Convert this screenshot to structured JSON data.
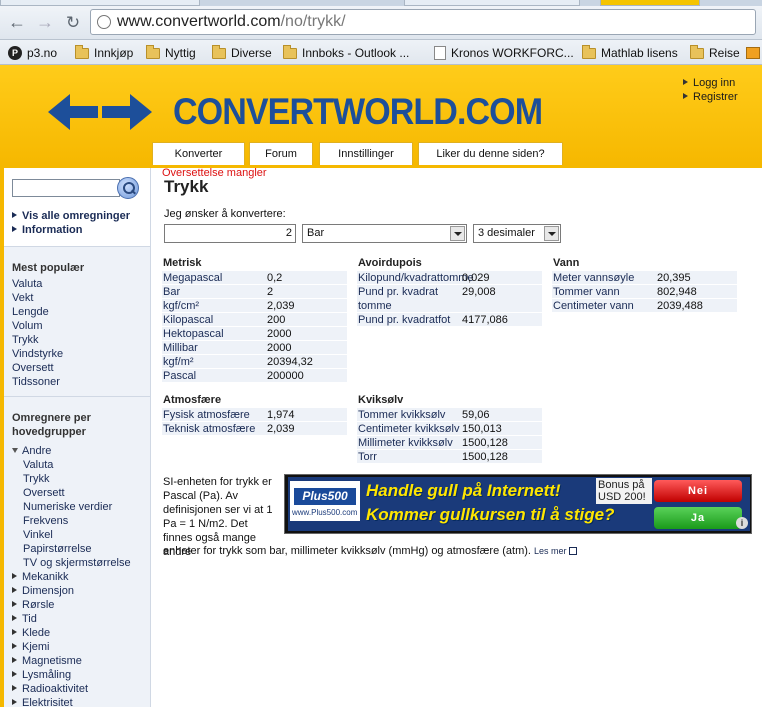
{
  "browser": {
    "url_host": "www.convertworld.com",
    "url_path": "/no/trykk/"
  },
  "bookmarks": [
    {
      "label": "p3.no",
      "icon": "p3-icon"
    },
    {
      "label": "Innkjøp",
      "icon": "folder-icon"
    },
    {
      "label": "Nyttig",
      "icon": "folder-icon"
    },
    {
      "label": "Diverse",
      "icon": "folder-icon"
    },
    {
      "label": "Innboks - Outlook ...",
      "icon": "folder-icon"
    },
    {
      "label": "Kronos WORKFORC...",
      "icon": "page-icon"
    },
    {
      "label": "Mathlab lisens",
      "icon": "folder-icon"
    },
    {
      "label": "Reise",
      "icon": "folder-icon"
    }
  ],
  "header": {
    "logo": "CONVERTWORLD.COM",
    "login": "Logg inn",
    "register": "Registrer",
    "menu": [
      "Konverter",
      "Forum",
      "Innstillinger",
      "Liker du denne siden?"
    ]
  },
  "sidebar": {
    "show_all": "Vis alle omregninger",
    "info": "Information",
    "popular_heading": "Mest populær",
    "popular": [
      "Valuta",
      "Vekt",
      "Lengde",
      "Volum",
      "Trykk",
      "Vindstyrke",
      "Oversett",
      "Tidssoner"
    ],
    "groups_heading": "Omregnere per hovedgrupper",
    "andre": "Andre",
    "andre_items": [
      "Valuta",
      "Trykk",
      "Oversett",
      "Numeriske verdier",
      "Frekvens",
      "Vinkel",
      "Papirstørrelse",
      "TV og skjermstørrelse"
    ],
    "collapsed": [
      "Mekanikk",
      "Dimensjon",
      "Rørsle",
      "Tid",
      "Klede",
      "Kjemi",
      "Magnetisme",
      "Lysmåling",
      "Radioaktivitet",
      "Elektrisitet"
    ]
  },
  "main": {
    "missing_translation": "Oversettelse mangler",
    "title": "Trykk",
    "lead": "Jeg ønsker å konvertere:",
    "input_value": "2",
    "unit_selected": "Bar",
    "decimals_selected": "3 desimaler",
    "groups": [
      {
        "title": "Metrisk",
        "rows": [
          {
            "label": "Megapascal",
            "value": "0,2"
          },
          {
            "label": "Bar",
            "value": "2"
          },
          {
            "label": "kgf/cm²",
            "value": "2,039"
          },
          {
            "label": "Kilopascal",
            "value": "200"
          },
          {
            "label": "Hektopascal",
            "value": "2000"
          },
          {
            "label": "Millibar",
            "value": "2000"
          },
          {
            "label": "kgf/m²",
            "value": "20394,32"
          },
          {
            "label": "Pascal",
            "value": "200000"
          }
        ]
      },
      {
        "title": "Avoirdupois",
        "rows": [
          {
            "label": "Kilopund/kvadrattomme",
            "value": "0,029"
          },
          {
            "label": "Pund pr. kvadrat tomme",
            "value": "29,008"
          },
          {
            "label": "Pund pr. kvadratfot",
            "value": "4177,086"
          }
        ]
      },
      {
        "title": "Vann",
        "rows": [
          {
            "label": "Meter vannsøyle",
            "value": "20,395"
          },
          {
            "label": "Tommer vann",
            "value": "802,948"
          },
          {
            "label": "Centimeter vann",
            "value": "2039,488"
          }
        ]
      },
      {
        "title": "Atmosfære",
        "rows": [
          {
            "label": "Fysisk atmosfære",
            "value": "1,974"
          },
          {
            "label": "Teknisk atmosfære",
            "value": "2,039"
          }
        ]
      },
      {
        "title": "Kviksølv",
        "rows": [
          {
            "label": "Tommer kvikksølv",
            "value": "59,06"
          },
          {
            "label": "Centimeter kvikksølv",
            "value": "150,013"
          },
          {
            "label": "Millimeter kvikksølv",
            "value": "1500,128"
          },
          {
            "label": "Torr",
            "value": "1500,128"
          }
        ]
      }
    ],
    "description": "SI-enheten for trykk er Pascal (Pa). Av definisjonen ser vi at 1 Pa = 1 N/m2. Det finnes også mange andre",
    "description_cont": "enheter for trykk som bar, millimeter kvikksølv (mmHg) og atmosfære (atm).",
    "read_more": "Les mer"
  },
  "ad": {
    "brand": "Plus500",
    "site": "www.Plus500.com",
    "line1": "Handle gull på Internett!",
    "line2": "Kommer gullkursen til å stige?",
    "bonus": "Bonus på USD 200!",
    "no": "Nei",
    "yes": "Ja",
    "info": "i"
  }
}
